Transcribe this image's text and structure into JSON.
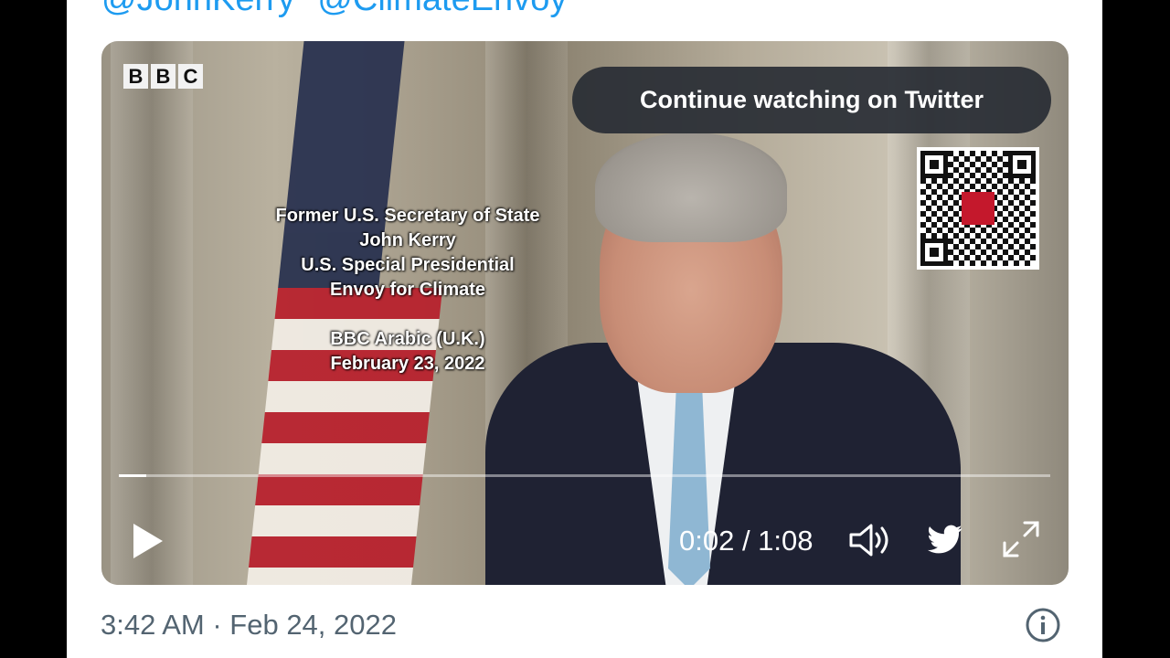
{
  "tweet": {
    "mentions": [
      "@JohnKerry",
      "@ClimateEnvoy"
    ],
    "timestamp": "3:42 AM · Feb 24, 2022"
  },
  "video": {
    "watermark": [
      "B",
      "B",
      "C"
    ],
    "caption_lines": [
      "Former U.S. Secretary of State",
      "John Kerry",
      "U.S. Special Presidential",
      "Envoy for Climate",
      "",
      "BBC Arabic (U.K.)",
      "February 23, 2022"
    ],
    "continue_label": "Continue watching on Twitter",
    "time_display": "0:02 / 1:08",
    "progress_fraction": 0.029
  },
  "colors": {
    "accent": "#1d9bf0",
    "meta_text": "#536471"
  },
  "icons": [
    "play-icon",
    "volume-icon",
    "twitter-bird-icon",
    "fullscreen-icon",
    "info-icon",
    "qr-code-icon"
  ]
}
